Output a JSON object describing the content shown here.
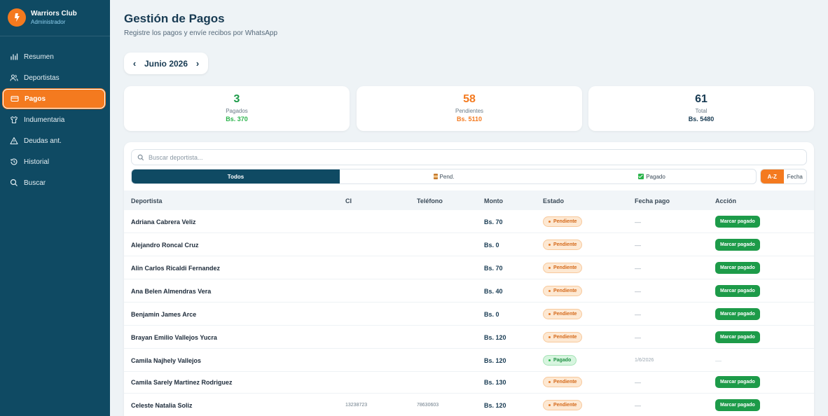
{
  "brand": {
    "name": "Warriors Club",
    "role": "Administrador"
  },
  "nav": [
    {
      "label": "Resumen",
      "icon": "bar-chart-icon"
    },
    {
      "label": "Deportistas",
      "icon": "users-icon"
    },
    {
      "label": "Pagos",
      "icon": "credit-card-icon",
      "active": true
    },
    {
      "label": "Indumentaria",
      "icon": "shirt-icon"
    },
    {
      "label": "Deudas ant.",
      "icon": "warning-icon"
    },
    {
      "label": "Historial",
      "icon": "history-icon"
    },
    {
      "label": "Buscar",
      "icon": "search-icon"
    }
  ],
  "header": {
    "title": "Gestión de Pagos",
    "subtitle": "Registre los pagos y envíe recibos por WhatsApp"
  },
  "month": {
    "label": "Junio 2026",
    "prev": "‹",
    "next": "›"
  },
  "stats": [
    {
      "value": "3",
      "label": "Pagados",
      "amount": "Bs. 370",
      "color": "#1d9b49"
    },
    {
      "value": "58",
      "label": "Pendientes",
      "amount": "Bs. 5110",
      "color": "#f47a1f"
    },
    {
      "value": "61",
      "label": "Total",
      "amount": "Bs. 5480",
      "color": "#173a52"
    }
  ],
  "search": {
    "placeholder": "Buscar deportista..."
  },
  "filters": {
    "all": "Todos",
    "pending": "Pend.",
    "paid": "Pagado"
  },
  "sort": {
    "az": "A-Z",
    "date": "Fecha"
  },
  "table": {
    "headers": {
      "name": "Deportista",
      "ci": "CI",
      "tel": "Teléfono",
      "amount": "Monto",
      "status": "Estado",
      "date": "Fecha pago",
      "action": "Acción"
    },
    "action_label": "Marcar pagado",
    "rows": [
      {
        "name": "Adriana Cabrera Veliz",
        "ci": "",
        "tel": "",
        "amount": "Bs. 70",
        "status": "Pendiente",
        "paid": false,
        "date": "—"
      },
      {
        "name": "Alejandro Roncal Cruz",
        "ci": "",
        "tel": "",
        "amount": "Bs. 0",
        "status": "Pendiente",
        "paid": false,
        "date": "—"
      },
      {
        "name": "Alin Carlos Ricaldi Fernandez",
        "ci": "",
        "tel": "",
        "amount": "Bs. 70",
        "status": "Pendiente",
        "paid": false,
        "date": "—"
      },
      {
        "name": "Ana Belen Almendras Vera",
        "ci": "",
        "tel": "",
        "amount": "Bs. 40",
        "status": "Pendiente",
        "paid": false,
        "date": "—"
      },
      {
        "name": "Benjamin James Arce",
        "ci": "",
        "tel": "",
        "amount": "Bs. 0",
        "status": "Pendiente",
        "paid": false,
        "date": "—"
      },
      {
        "name": "Brayan Emilio Vallejos Yucra",
        "ci": "",
        "tel": "",
        "amount": "Bs. 120",
        "status": "Pendiente",
        "paid": false,
        "date": "—"
      },
      {
        "name": "Camila Najhely Vallejos",
        "ci": "",
        "tel": "",
        "amount": "Bs. 120",
        "status": "Pagado",
        "paid": true,
        "date": "1/6/2026",
        "action_text": "—"
      },
      {
        "name": "Camila Sarely Martinez Rodriguez",
        "ci": "",
        "tel": "",
        "amount": "Bs. 130",
        "status": "Pendiente",
        "paid": false,
        "date": "—"
      },
      {
        "name": "Celeste Natalia Soliz",
        "ci": "13238723",
        "tel": "78630603",
        "amount": "Bs. 120",
        "status": "Pendiente",
        "paid": false,
        "date": "—"
      }
    ]
  }
}
